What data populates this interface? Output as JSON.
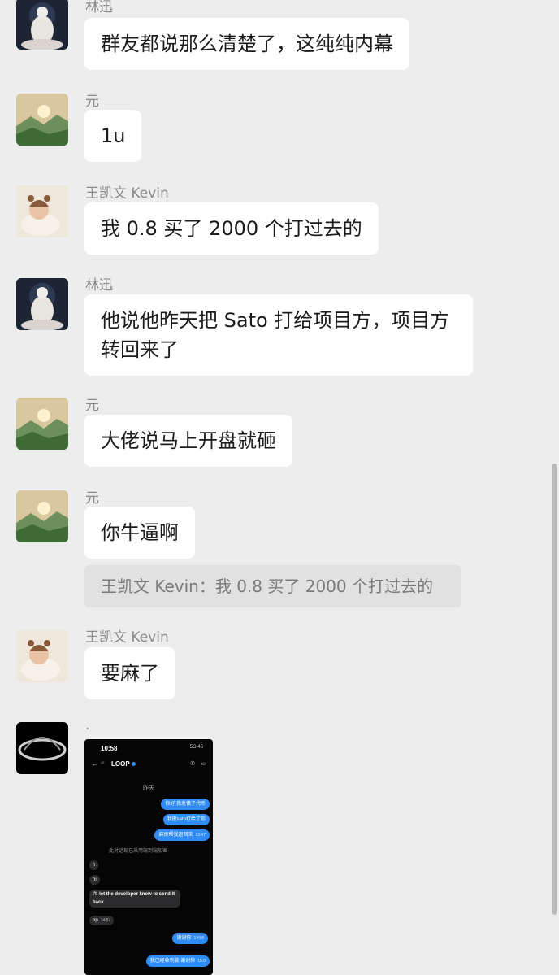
{
  "messages": [
    {
      "sender": "林迅",
      "text": "群友都说那么清楚了，这纯纯内幕"
    },
    {
      "sender": "元",
      "text": "1u"
    },
    {
      "sender": "王凯文 Kevin",
      "text": "我 0.8 买了 2000 个打过去的"
    },
    {
      "sender": "林迅",
      "text": "他说他昨天把 Sato 打给项目方，项目方转回来了"
    },
    {
      "sender": "元",
      "text": "大佬说马上开盘就砸"
    },
    {
      "sender": "元",
      "text": "你牛逼啊"
    },
    {
      "sender": "王凯文 Kevin",
      "text": "要麻了"
    },
    {
      "sender": "."
    }
  ],
  "quote": {
    "text": "王凯文 Kevin：我 0.8 买了 2000 个打过去的"
  },
  "screenshot": {
    "status_time": "10:58",
    "network": "5G",
    "battery": "46",
    "lvl": "¹⁰",
    "contact": "LOOP",
    "day": "昨天",
    "out1": "你好 我发错了代币",
    "out2": "我把sato打给了你",
    "out3": "麻烦帮我退回来",
    "out3_time": "13:47",
    "encrypted": "此对话现已采用端到端加密",
    "in1": "h",
    "in2": "hi",
    "in3": "I'll let the developer know to send it back",
    "in4": "np",
    "in4_time": "14:57",
    "out4": "谢谢你",
    "out4_time": "14:58",
    "out5": "我已经收到款 谢谢你",
    "out5_time": "15:0"
  }
}
